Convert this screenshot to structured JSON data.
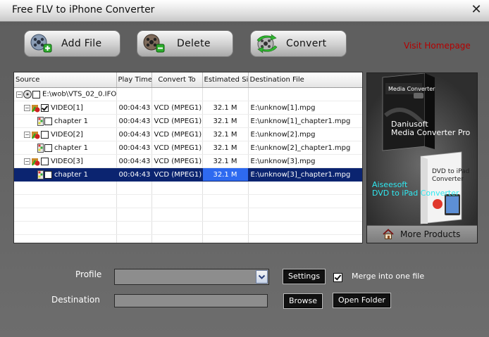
{
  "window": {
    "title": "Free FLV to iPhone Converter"
  },
  "toolbar": {
    "add_file": "Add  File",
    "delete": "Delete",
    "convert": "Convert"
  },
  "header_link": "Visit Homepage",
  "table": {
    "columns": [
      "Source",
      "Play Time",
      "Convert To",
      "Estimated Size",
      "Destination File"
    ],
    "root": {
      "name": "E:\\wob\\VTS_02_0.IFO"
    },
    "rows": [
      {
        "name": "VIDEO[1]",
        "play_time": "00:04:43",
        "convert_to": "VCD (MPEG1)",
        "size": "32.1 M",
        "dest": "E:\\unknow[1].mpg"
      },
      {
        "name": "chapter 1",
        "play_time": "00:04:43",
        "convert_to": "VCD (MPEG1)",
        "size": "32.1 M",
        "dest": "E:\\unknow[1]_chapter1.mpg"
      },
      {
        "name": "VIDEO[2]",
        "play_time": "00:04:43",
        "convert_to": "VCD (MPEG1)",
        "size": "32.1 M",
        "dest": "E:\\unknow[2].mpg"
      },
      {
        "name": "chapter 1",
        "play_time": "00:04:43",
        "convert_to": "VCD (MPEG1)",
        "size": "32.1 M",
        "dest": "E:\\unknow[2]_chapter1.mpg"
      },
      {
        "name": "VIDEO[3]",
        "play_time": "00:04:43",
        "convert_to": "VCD (MPEG1)",
        "size": "32.1 M",
        "dest": "E:\\unknow[3].mpg"
      },
      {
        "name": "chapter 1",
        "play_time": "00:04:43",
        "convert_to": "VCD (MPEG1)",
        "size": "32.1 M",
        "dest": "E:\\unknow[3]_chapter1.mpg"
      }
    ]
  },
  "promo": {
    "product1": {
      "line1": "Daniusoft",
      "line2": "Media Converter Pro",
      "box_title": "Media Converter"
    },
    "product2": {
      "line1": "Aiseesoft",
      "line2": "DVD to iPad Converter",
      "box_title_1": "DVD to iPad",
      "box_title_2": "Converter"
    },
    "more_products": "More Products"
  },
  "form": {
    "profile_label": "Profile",
    "profile_value": "",
    "settings": "Settings",
    "merge_label": "Merge into one file",
    "destination_label": "Destination",
    "destination_value": "",
    "browse": "Browse",
    "open_folder": "Open Folder"
  },
  "colors": {
    "selected_row": "#0b2470",
    "selected_cell": "#2e6af0",
    "link": "#b50000",
    "promo_cyan": "#2fe8f0"
  }
}
